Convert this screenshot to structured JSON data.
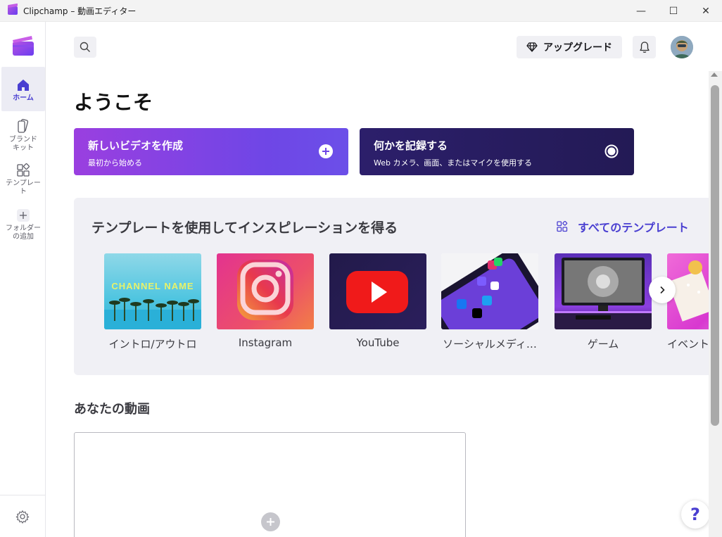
{
  "window": {
    "title": "Clipchamp – 動画エディター",
    "minimize": "—",
    "maximize": "☐",
    "close": "✕"
  },
  "sidebar": {
    "items": [
      {
        "label": "ホーム",
        "icon": "home-icon",
        "active": true
      },
      {
        "label": "ブランド\nキット",
        "icon": "brand-kit-icon"
      },
      {
        "label": "テンプレー\nト",
        "icon": "templates-icon"
      },
      {
        "label": "フォルダー\nの追加",
        "icon": "add-folder-icon"
      }
    ],
    "settings_icon": "gear-icon"
  },
  "header": {
    "upgrade_label": "アップグレード"
  },
  "main": {
    "welcome": "ようこそ",
    "create_video": {
      "title": "新しいビデオを作成",
      "subtitle": "最初から始める"
    },
    "record": {
      "title": "何かを記録する",
      "subtitle": "Web カメラ、画面、またはマイクを使用する"
    }
  },
  "templates": {
    "heading": "テンプレートを使用してインスピレーションを得る",
    "all_link": "すべてのテンプレート",
    "cards": [
      {
        "label": "イントロ/アウトロ",
        "thumb_text": "CHANNEL NAME"
      },
      {
        "label": "Instagram"
      },
      {
        "label": "YouTube"
      },
      {
        "label": "ソーシャルメディ…"
      },
      {
        "label": "ゲーム"
      },
      {
        "label": "イベント"
      }
    ]
  },
  "videos": {
    "heading": "あなたの動画"
  },
  "help_label": "?",
  "colors": {
    "accent": "#4a3fd1",
    "cta_new_start": "#9a3fe0",
    "cta_new_end": "#6b4fe8",
    "cta_record": "#2c1f6b",
    "panel_bg": "#f0f0f5"
  }
}
